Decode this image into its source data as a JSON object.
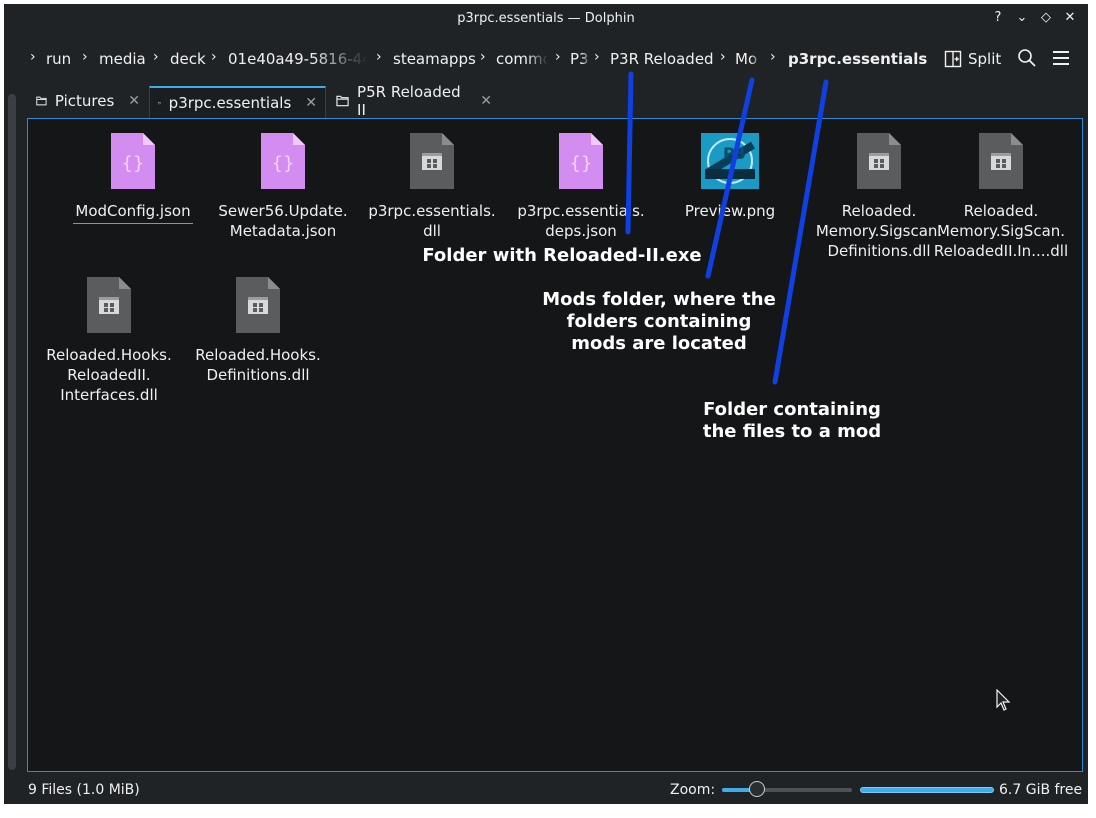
{
  "window": {
    "title": "p3rpc.essentials — Dolphin",
    "controls": [
      "?",
      "⌄",
      "◇",
      "✕"
    ]
  },
  "breadcrumb": {
    "items": [
      "run",
      "media",
      "deck",
      "01e40a49-5816-44d",
      "steamapps",
      "commo",
      "P3",
      "P3R Reloaded",
      "Mo",
      "p3rpc.essentials"
    ]
  },
  "toolbar": {
    "split_label": "Split",
    "search_icon": "search-icon",
    "menu_icon": "hamburger-menu-icon"
  },
  "tabs": [
    {
      "label": "Pictures",
      "active": false
    },
    {
      "label": "p3rpc.essentials",
      "active": true
    },
    {
      "label": "P5R Reloaded II",
      "active": false
    }
  ],
  "files": [
    {
      "name": "ModConfig.json",
      "icon": "json-file-icon"
    },
    {
      "name": "Sewer56.Update.\nMetadata.json",
      "icon": "json-file-icon"
    },
    {
      "name": "p3rpc.essentials.\ndll",
      "icon": "dll-file-icon"
    },
    {
      "name": "p3rpc.essentials.\ndeps.json",
      "icon": "json-file-icon"
    },
    {
      "name": "Preview.png",
      "icon": "image-thumbnail"
    },
    {
      "name": "Reloaded.\nMemory.Sigscan.\nDefinitions.dll",
      "icon": "dll-file-icon"
    },
    {
      "name": "Reloaded.\nMemory.SigScan.\nReloadedII.In....dll",
      "icon": "dll-file-icon"
    },
    {
      "name": "Reloaded.Hooks.\nReloadedII.\nInterfaces.dll",
      "icon": "dll-file-icon"
    },
    {
      "name": "Reloaded.Hooks.\nDefinitions.dll",
      "icon": "dll-file-icon"
    }
  ],
  "annotations": {
    "reloaded_folder": "Folder with Reloaded-II.exe",
    "mods_folder": "Mods folder, where the\nfolders containing\nmods are located",
    "mod_folder": "Folder containing\nthe files to a mod",
    "line_color": "#1040e0"
  },
  "status": {
    "summary": "9 Files (1.0 MiB)",
    "zoom_label": "Zoom:",
    "free_space": "6.7 GiB free"
  },
  "colors": {
    "accent": "#3daee9",
    "window_bg": "#202326",
    "view_bg": "#141618",
    "json_icon": "#d38cf0",
    "dll_icon": "#5a5c5e"
  }
}
